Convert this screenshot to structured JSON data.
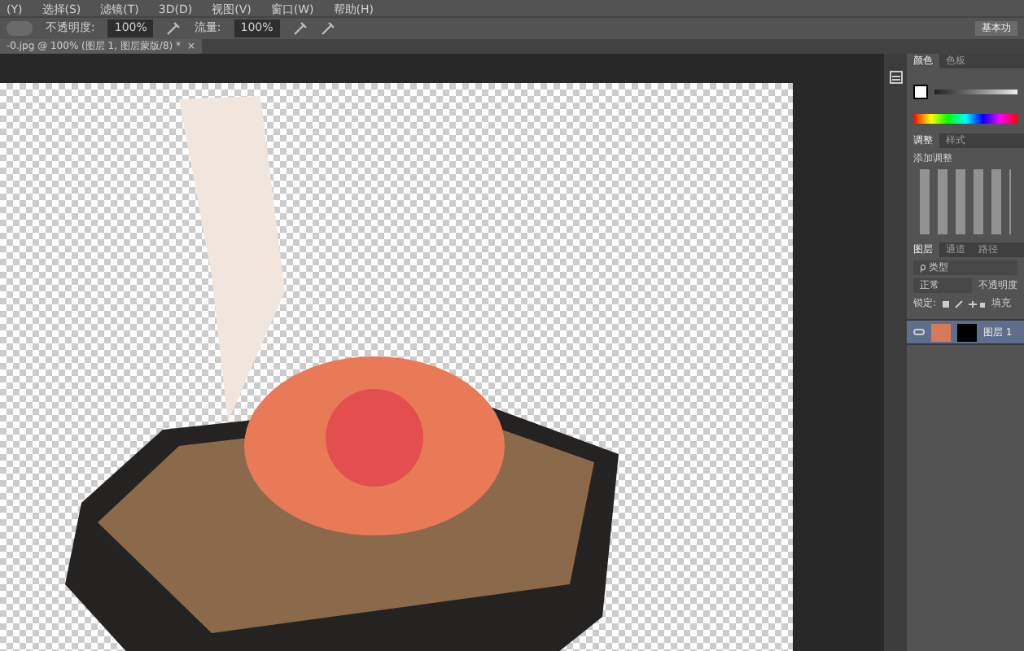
{
  "menu": [
    "(Y)",
    "选择(S)",
    "滤镜(T)",
    "3D(D)",
    "视图(V)",
    "窗口(W)",
    "帮助(H)"
  ],
  "options_bar": {
    "opacity_label": "不透明度:",
    "opacity": "100%",
    "flow_label": "流量:",
    "flow": "100%",
    "right_button": "基本功"
  },
  "document_tab": {
    "title": "-0.jpg @ 100% (图层 1, 图层蒙版/8) *",
    "close": "×"
  },
  "color_panel": {
    "tabs": [
      {
        "label": "颜色",
        "selected": true
      },
      {
        "label": "色板",
        "selected": false
      }
    ]
  },
  "adjustments_panel": {
    "tabs": [
      {
        "label": "调整",
        "selected": true
      },
      {
        "label": "样式",
        "selected": false
      }
    ],
    "heading": "添加调整"
  },
  "layers_panel": {
    "tabs": [
      {
        "label": "图层",
        "selected": true
      },
      {
        "label": "通道",
        "selected": false
      },
      {
        "label": "路径",
        "selected": false
      }
    ],
    "filter": "ρ 类型",
    "blend_mode": "正常",
    "opacity_label": "不透明度",
    "lock_label": "锁定:",
    "fill_label": "填充",
    "layers": [
      {
        "name": "图层 1",
        "selected": true,
        "visible": true
      }
    ]
  }
}
